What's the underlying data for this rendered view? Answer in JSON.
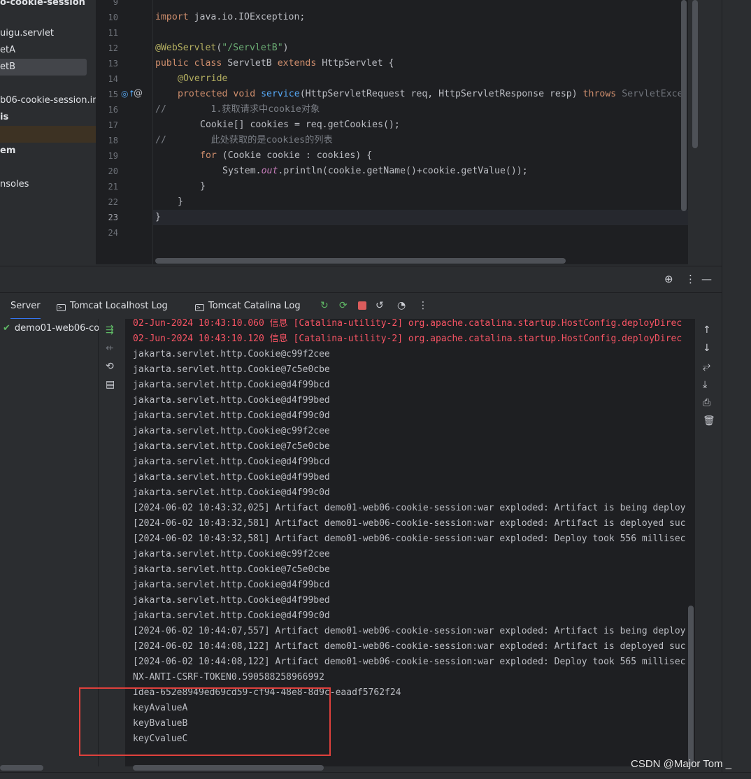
{
  "sidebar": {
    "items": [
      {
        "label": "o-cookie-session",
        "top": 0
      },
      {
        "label": "uigu.servlet"
      },
      {
        "label": "etA"
      },
      {
        "label": "etB"
      },
      {
        "label": "b06-cookie-session.in"
      },
      {
        "label": "is"
      },
      {
        "label": "em"
      },
      {
        "label": "nsoles"
      }
    ]
  },
  "editor": {
    "line_numbers": [
      "9",
      "10",
      "11",
      "12",
      "13",
      "14",
      "15",
      "16",
      "17",
      "18",
      "19",
      "20",
      "21",
      "22",
      "23",
      "24"
    ],
    "lines": {
      "l10_kw": "import",
      "l10_rest": " java.io.IOException;",
      "l12_ann": "@WebServlet",
      "l12_p1": "(",
      "l12_str": "\"/ServletB\"",
      "l12_p2": ")",
      "l13_kw1": "public class",
      "l13_name": " ServletB ",
      "l13_kw2": "extends",
      "l13_rest": " HttpServlet {",
      "l14_ann": "@Override",
      "l15_kw": "protected void",
      "l15_fn": "service",
      "l15_rest": "(HttpServletRequest req, HttpServletResponse resp) ",
      "l15_kw2": "throws",
      "l15_gray": " ServletExce",
      "l16": "//        1.获取请求中cookie对象",
      "l17": "Cookie[] cookies = req.getCookies();",
      "l18": "//        此处获取的是cookies的列表",
      "l19_kw": "for",
      "l19_rest": " (Cookie cookie : cookies) {",
      "l20_a": "System.",
      "l20_stat": "out",
      "l20_b": ".println(cookie.getName()+cookie.getValue());",
      "l21": "}",
      "l22": "}",
      "l23": "}"
    }
  },
  "tabs": [
    {
      "label": "Server"
    },
    {
      "label": "Tomcat Localhost Log"
    },
    {
      "label": "Tomcat Catalina Log"
    }
  ],
  "services": {
    "deployment": "demo01-web06-co"
  },
  "console": {
    "lines": [
      {
        "text": "02-Jun-2024 10:43:10.060 信息 [Catalina-utility-2] org.apache.catalina.startup.HostConfig.deployDirec",
        "red": true
      },
      {
        "text": "02-Jun-2024 10:43:10.120 信息 [Catalina-utility-2] org.apache.catalina.startup.HostConfig.deployDirec",
        "red": true
      },
      {
        "text": "jakarta.servlet.http.Cookie@c99f2cee"
      },
      {
        "text": "jakarta.servlet.http.Cookie@7c5e0cbe"
      },
      {
        "text": "jakarta.servlet.http.Cookie@d4f99bcd"
      },
      {
        "text": "jakarta.servlet.http.Cookie@d4f99bed"
      },
      {
        "text": "jakarta.servlet.http.Cookie@d4f99c0d"
      },
      {
        "text": "jakarta.servlet.http.Cookie@c99f2cee"
      },
      {
        "text": "jakarta.servlet.http.Cookie@7c5e0cbe"
      },
      {
        "text": "jakarta.servlet.http.Cookie@d4f99bcd"
      },
      {
        "text": "jakarta.servlet.http.Cookie@d4f99bed"
      },
      {
        "text": "jakarta.servlet.http.Cookie@d4f99c0d"
      },
      {
        "text": "[2024-06-02 10:43:32,025] Artifact demo01-web06-cookie-session:war exploded: Artifact is being deploy"
      },
      {
        "text": "[2024-06-02 10:43:32,581] Artifact demo01-web06-cookie-session:war exploded: Artifact is deployed suc"
      },
      {
        "text": "[2024-06-02 10:43:32,581] Artifact demo01-web06-cookie-session:war exploded: Deploy took 556 millisec"
      },
      {
        "text": "jakarta.servlet.http.Cookie@c99f2cee"
      },
      {
        "text": "jakarta.servlet.http.Cookie@7c5e0cbe"
      },
      {
        "text": "jakarta.servlet.http.Cookie@d4f99bcd"
      },
      {
        "text": "jakarta.servlet.http.Cookie@d4f99bed"
      },
      {
        "text": "jakarta.servlet.http.Cookie@d4f99c0d"
      },
      {
        "text": "[2024-06-02 10:44:07,557] Artifact demo01-web06-cookie-session:war exploded: Artifact is being deploy"
      },
      {
        "text": "[2024-06-02 10:44:08,122] Artifact demo01-web06-cookie-session:war exploded: Artifact is deployed suc"
      },
      {
        "text": "[2024-06-02 10:44:08,122] Artifact demo01-web06-cookie-session:war exploded: Deploy took 565 millisec"
      },
      {
        "text": "NX-ANTI-CSRF-TOKEN0.590588258966992"
      },
      {
        "text": "Idea-652e8949ed69cd59-cf94-48e8-8d9c-eaadf5762f24"
      },
      {
        "text": "keyAvalueA"
      },
      {
        "text": "keyBvalueB"
      },
      {
        "text": "keyCvalueC"
      }
    ]
  },
  "watermark": "CSDN @Major Tom _",
  "colors": {
    "highlight_box": "#e0403c",
    "error_text": "#f75464"
  }
}
